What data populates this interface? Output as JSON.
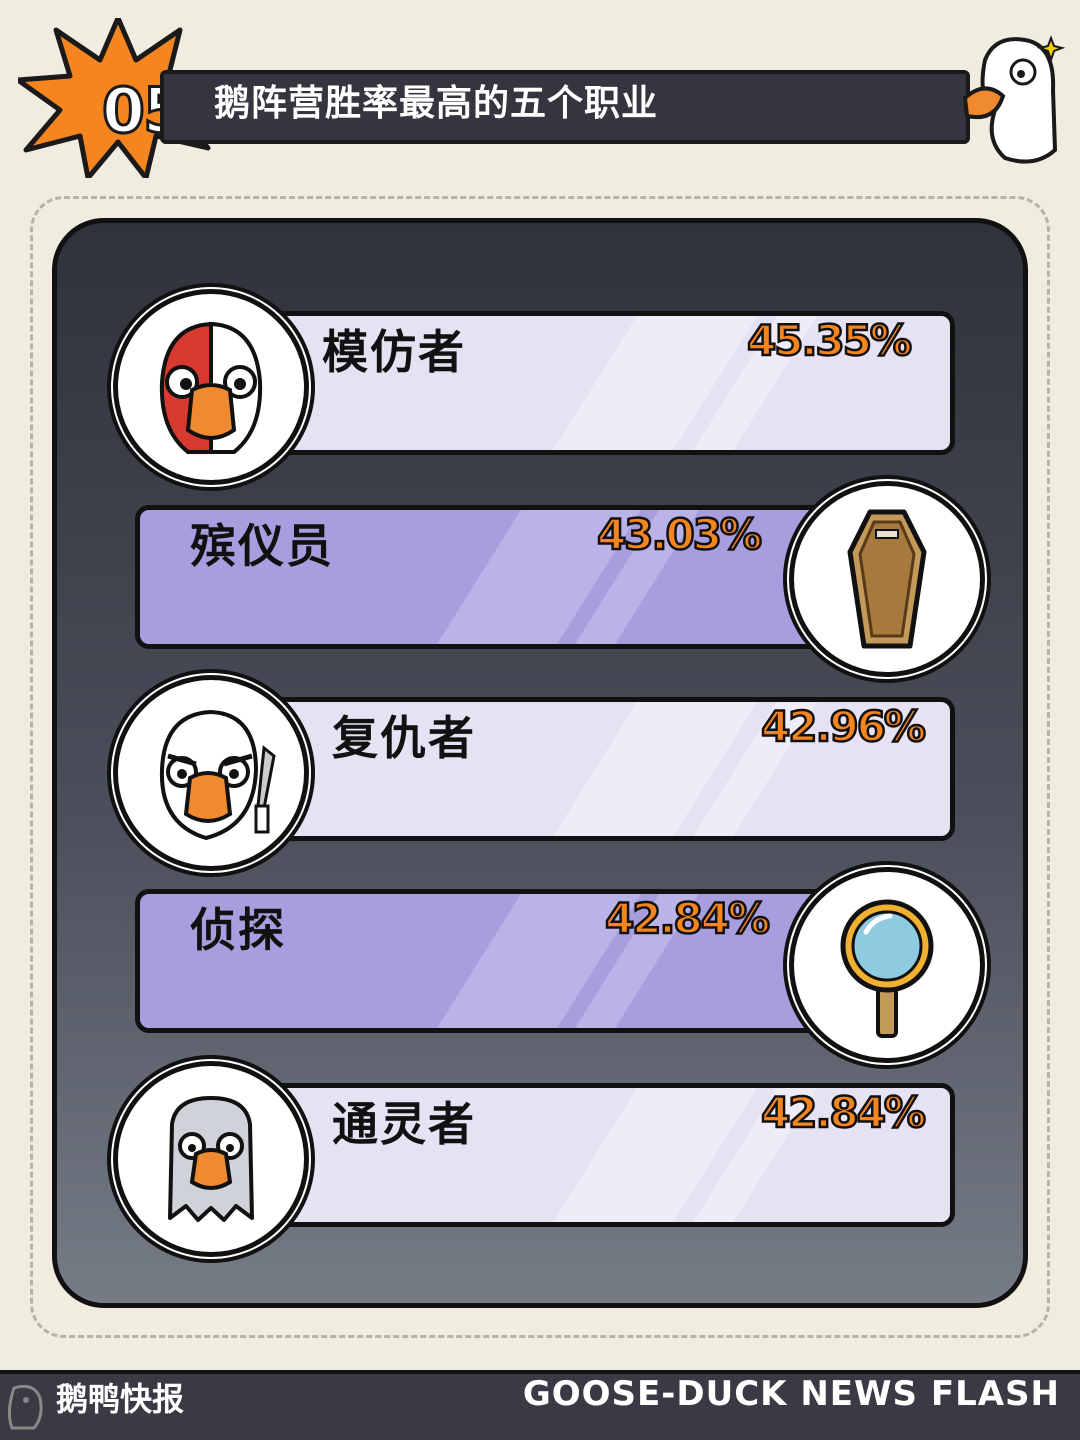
{
  "header": {
    "number": "05",
    "title": "鹅阵营胜率最高的五个职业"
  },
  "roles": [
    {
      "name": "模仿者",
      "rate": "45.35%",
      "icon": "mimic-goose-icon",
      "style": "light",
      "icon_side": "left"
    },
    {
      "name": "殡仪员",
      "rate": "43.03%",
      "icon": "coffin-icon",
      "style": "dark",
      "icon_side": "right"
    },
    {
      "name": "复仇者",
      "rate": "42.96%",
      "icon": "avenger-goose-knife-icon",
      "style": "light",
      "icon_side": "left"
    },
    {
      "name": "侦探",
      "rate": "42.84%",
      "icon": "magnifying-glass-icon",
      "style": "dark",
      "icon_side": "right"
    },
    {
      "name": "通灵者",
      "rate": "42.84%",
      "icon": "ghost-goose-icon",
      "style": "light",
      "icon_side": "left"
    }
  ],
  "footer": {
    "left": "鹅鸭快报",
    "right": "GOOSE-DUCK NEWS FLASH"
  },
  "colors": {
    "background": "#f1ece0",
    "panel": "#3a3d47",
    "bar_light": "#e6e2f4",
    "bar_dark": "#a79ee0",
    "rate": "#f5851f"
  }
}
